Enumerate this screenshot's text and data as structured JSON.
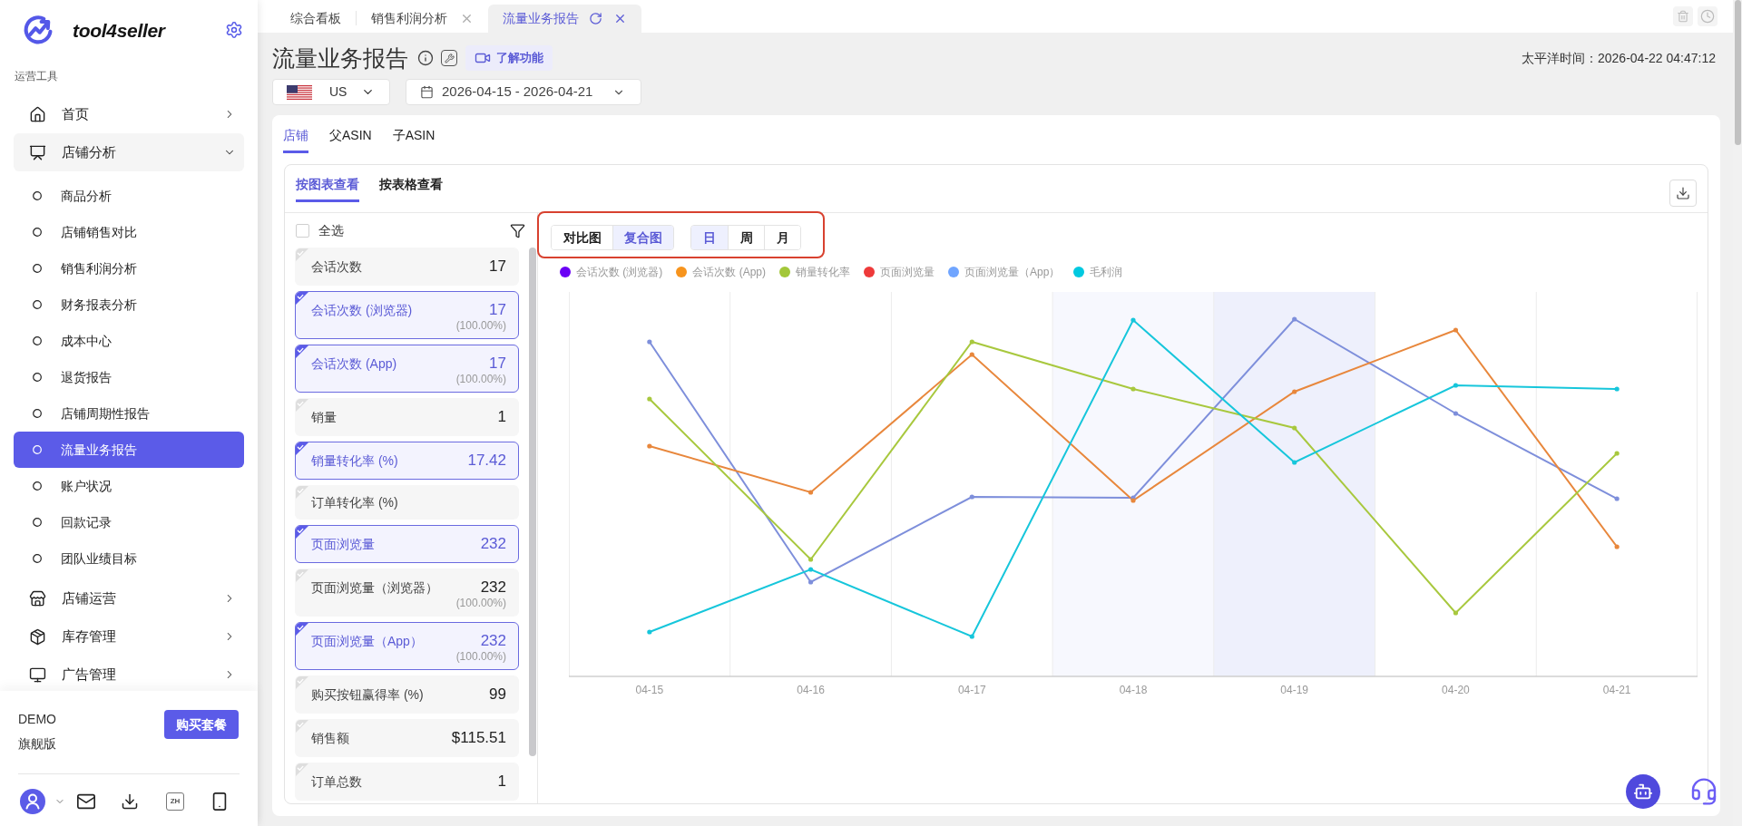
{
  "sidebar": {
    "brand": "tool4seller",
    "section_label": "运营工具",
    "menu": [
      {
        "label": "首页",
        "expanded": false
      },
      {
        "label": "店铺分析",
        "expanded": true,
        "children": [
          {
            "label": "商品分析",
            "selected": false
          },
          {
            "label": "店铺销售对比",
            "selected": false
          },
          {
            "label": "销售利润分析",
            "selected": false
          },
          {
            "label": "财务报表分析",
            "selected": false
          },
          {
            "label": "成本中心",
            "selected": false
          },
          {
            "label": "退货报告",
            "selected": false
          },
          {
            "label": "店铺周期性报告",
            "selected": false
          },
          {
            "label": "流量业务报告",
            "selected": true
          },
          {
            "label": "账户状况",
            "selected": false
          },
          {
            "label": "回款记录",
            "selected": false
          },
          {
            "label": "团队业绩目标",
            "selected": false
          }
        ]
      },
      {
        "label": "店铺运营",
        "expanded": false
      },
      {
        "label": "库存管理",
        "expanded": false
      },
      {
        "label": "广告管理",
        "expanded": false
      }
    ],
    "account": "DEMO",
    "plan": "旗舰版",
    "buy_button": "购买套餐",
    "language": "ZH"
  },
  "tabs": [
    {
      "label": "综合看板",
      "selected": false,
      "closable": false
    },
    {
      "label": "销售利润分析",
      "selected": false,
      "closable": true
    },
    {
      "label": "流量业务报告",
      "selected": true,
      "closable": true
    }
  ],
  "header": {
    "title": "流量业务报告",
    "learn_button": "了解功能",
    "time": "太平洋时间：2026-04-22 04:47:12",
    "marketplace": "US",
    "date_start": "2026-04-15",
    "date_separator": "-",
    "date_end": "2026-04-21"
  },
  "scope_tabs": [
    {
      "label": "店铺",
      "selected": true
    },
    {
      "label": "父ASIN",
      "selected": false
    },
    {
      "label": "子ASIN",
      "selected": false
    }
  ],
  "view_tabs": [
    {
      "label": "按图表查看",
      "selected": true
    },
    {
      "label": "按表格查看",
      "selected": false
    }
  ],
  "metrics": {
    "select_all": {
      "label": "全选",
      "checked": false
    },
    "items": [
      {
        "label": "会话次数",
        "value": "17",
        "selected": false
      },
      {
        "label": "会话次数 (浏览器)",
        "value": "17",
        "share": "(100.00%)",
        "selected": true
      },
      {
        "label": "会话次数 (App)",
        "value": "17",
        "share": "(100.00%)",
        "selected": true
      },
      {
        "label": "销量",
        "value": "1",
        "selected": false
      },
      {
        "label": "销量转化率 (%)",
        "value": "17.42",
        "selected": true
      },
      {
        "label": "订单转化率 (%)",
        "selected": false
      },
      {
        "label": "页面浏览量",
        "value": "232",
        "selected": true
      },
      {
        "label": "页面浏览量（浏览器）",
        "value": "232",
        "share": "(100.00%)",
        "selected": false
      },
      {
        "label": "页面浏览量（App）",
        "value": "232",
        "share": "(100.00%)",
        "selected": true
      },
      {
        "label": "购买按钮赢得率 (%)",
        "value": "99",
        "selected": false
      },
      {
        "label": "销售额",
        "value": "$115.51",
        "selected": false
      },
      {
        "label": "订单总数",
        "value": "1",
        "selected": false
      }
    ]
  },
  "chart": {
    "chart_types": [
      {
        "label": "对比图",
        "selected": false
      },
      {
        "label": "复合图",
        "selected": true
      }
    ],
    "periods": [
      {
        "label": "日",
        "selected": true
      },
      {
        "label": "周",
        "selected": false
      },
      {
        "label": "月",
        "selected": false
      }
    ],
    "legend": [
      {
        "label": "会话次数 (浏览器)",
        "color": "#6a00f5"
      },
      {
        "label": "会话次数 (App)",
        "color": "#f7941d"
      },
      {
        "label": "销量转化率",
        "color": "#a3c739"
      },
      {
        "label": "页面浏览量",
        "color": "#ee3a3a"
      },
      {
        "label": "页面浏览量（App）",
        "color": "#70a5ff"
      },
      {
        "label": "毛利润",
        "color": "#00c9e0"
      }
    ],
    "x_labels": [
      "04-15",
      "04-16",
      "04-17",
      "04-18",
      "04-19",
      "04-20",
      "04-21"
    ]
  }
}
